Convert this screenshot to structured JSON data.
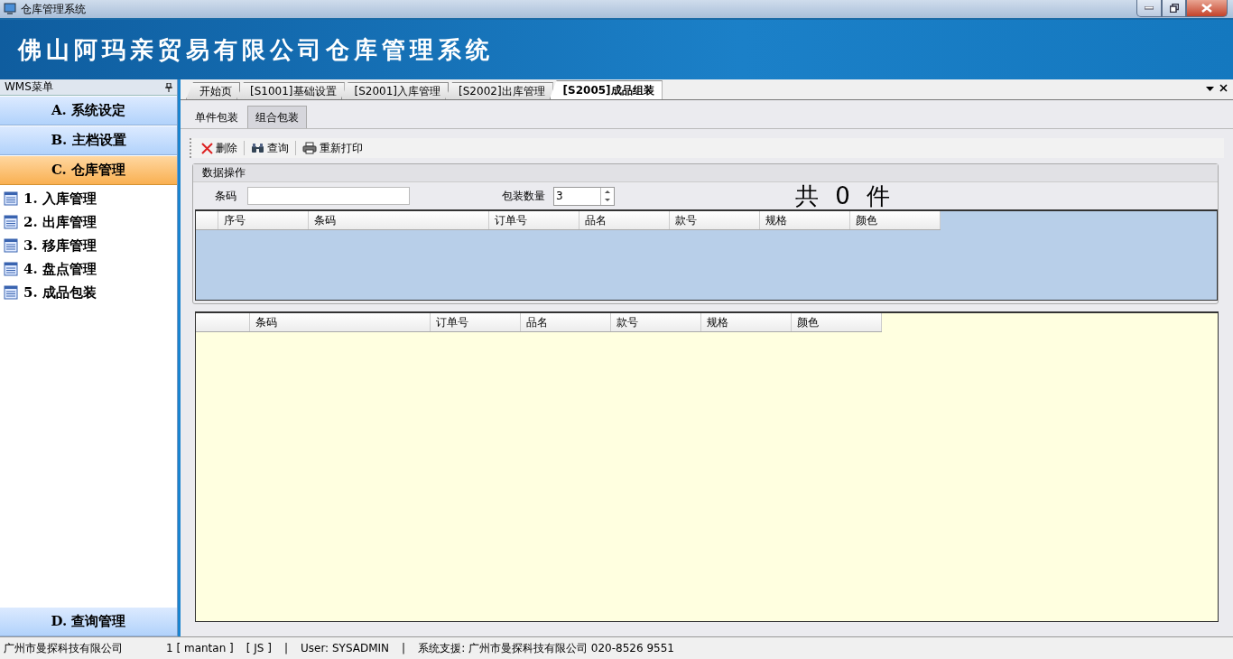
{
  "window": {
    "title": "仓库管理系统"
  },
  "banner": {
    "title": "佛山阿玛亲贸易有限公司仓库管理系统"
  },
  "sidebar": {
    "title": "WMS菜单",
    "groups": [
      {
        "label": "A. 系统设定",
        "selected": false
      },
      {
        "label": "B. 主档设置",
        "selected": false
      },
      {
        "label": "C. 仓库管理",
        "selected": true,
        "children": [
          {
            "label": "1. 入库管理"
          },
          {
            "label": "2. 出库管理"
          },
          {
            "label": "3. 移库管理"
          },
          {
            "label": "4. 盘点管理"
          },
          {
            "label": "5. 成品包装"
          }
        ]
      },
      {
        "label": "D. 查询管理",
        "selected": false
      }
    ]
  },
  "doc_tabs": [
    {
      "label": "开始页",
      "selected": false
    },
    {
      "label": "[S1001]基础设置",
      "selected": false
    },
    {
      "label": "[S2001]入库管理",
      "selected": false
    },
    {
      "label": "[S2002]出库管理",
      "selected": false
    },
    {
      "label": "[S2005]成品组装",
      "selected": true
    }
  ],
  "sub_tabs": [
    {
      "label": "单件包装",
      "selected": false
    },
    {
      "label": "组合包装",
      "selected": true
    }
  ],
  "toolbar": [
    {
      "kind": "delete",
      "label": "删除"
    },
    {
      "kind": "search",
      "label": "查询"
    },
    {
      "kind": "print",
      "label": "重新打印"
    }
  ],
  "data_panel": {
    "title": "数据操作",
    "barcode_label": "条码",
    "quantity_label": "包装数量",
    "quantity": "3",
    "total": "共 0 件",
    "columns": [
      "序号",
      "条码",
      "订单号",
      "品名",
      "款号",
      "规格",
      "颜色"
    ]
  },
  "lower_grid": {
    "columns": [
      "条码",
      "订单号",
      "品名",
      "款号",
      "规格",
      "颜色"
    ]
  },
  "status_bar": [
    "广州市曼探科技有限公司",
    "1 [ mantan ]",
    "[ JS ]",
    "|",
    "User: SYSADMIN",
    "|",
    "系统支援: 广州市曼探科技有限公司 020-8526 9551"
  ]
}
